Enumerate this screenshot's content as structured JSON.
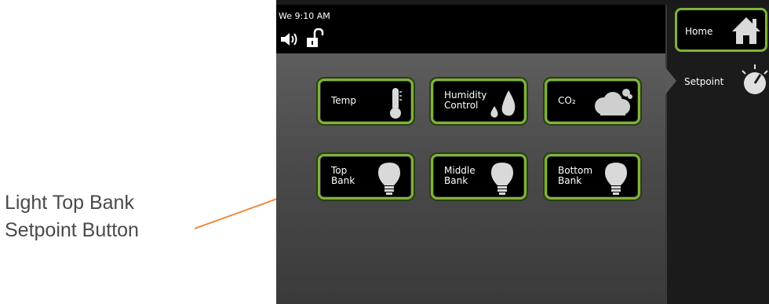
{
  "annotation": {
    "line1": "Light Top Bank",
    "line2": "Setpoint Button",
    "arrow_color": "#f08a3a"
  },
  "status_bar": {
    "clock": "We 9:10 AM",
    "icons": [
      "speaker-icon",
      "unlocked-padlock-icon"
    ]
  },
  "tiles": [
    {
      "label": "Temp",
      "icon": "thermometer-icon"
    },
    {
      "label": "Humidity\nControl",
      "icon": "water-drops-icon"
    },
    {
      "label": "CO₂",
      "icon": "cloud-icon"
    },
    {
      "label": "Top\nBank",
      "icon": "light-bulb-icon"
    },
    {
      "label": "Middle\nBank",
      "icon": "light-bulb-icon"
    },
    {
      "label": "Bottom\nBank",
      "icon": "light-bulb-icon"
    }
  ],
  "side_menu": {
    "home_label": "Home",
    "setpoint_label": "Setpoint"
  },
  "colors": {
    "accent_border": "#7fb33a",
    "tile_bg": "#000000"
  }
}
